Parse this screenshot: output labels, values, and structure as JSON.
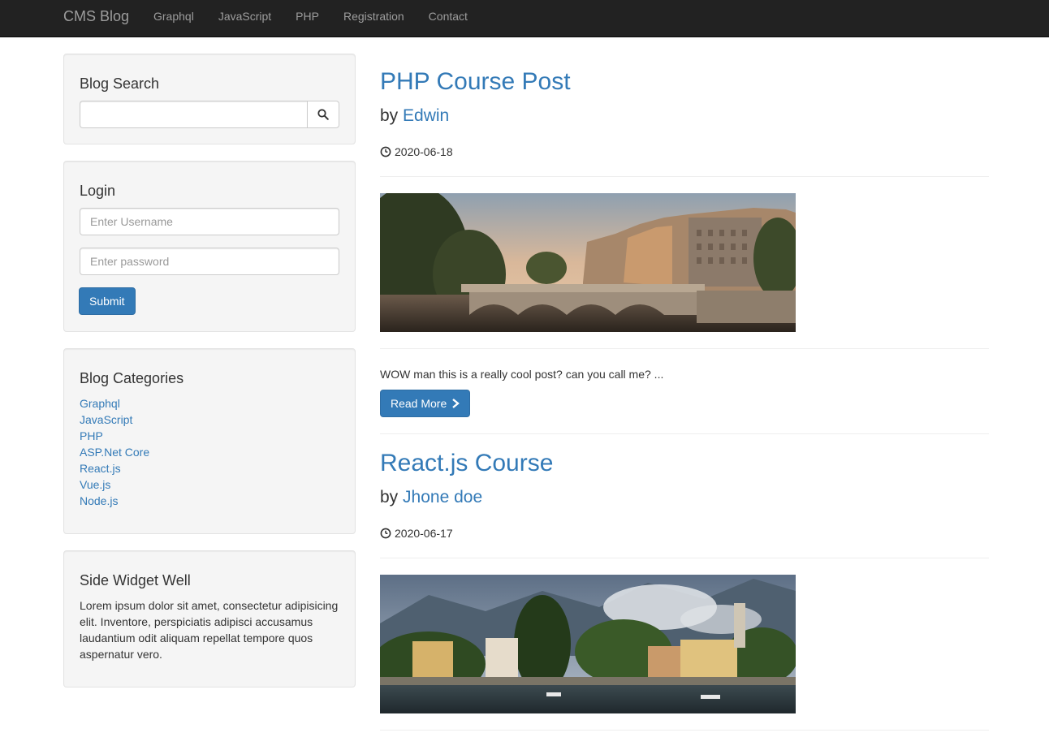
{
  "navbar": {
    "brand": "CMS Blog",
    "links": [
      "Graphql",
      "JavaScript",
      "PHP",
      "Registration",
      "Contact"
    ]
  },
  "search": {
    "title": "Blog Search",
    "icon": "search-icon"
  },
  "login": {
    "title": "Login",
    "username_placeholder": "Enter Username",
    "password_placeholder": "Enter password",
    "submit_label": "Submit"
  },
  "categories": {
    "title": "Blog Categories",
    "items": [
      "Graphql",
      "JavaScript",
      "PHP",
      "ASP.Net Core",
      "React.js",
      "Vue.js",
      "Node.js"
    ]
  },
  "widget": {
    "title": "Side Widget Well",
    "text": "Lorem ipsum dolor sit amet, consectetur adipisicing elit. Inventore, perspiciatis adipisci accusamus laudantium odit aliquam repellat tempore quos aspernatur vero."
  },
  "posts": [
    {
      "title": "PHP Course Post",
      "by": "by",
      "author": "Edwin",
      "date": "2020-06-18",
      "excerpt": "WOW man this is a really cool post? can you call me? ...",
      "read_more": "Read More"
    },
    {
      "title": "React.js Course",
      "by": "by",
      "author": "Jhone doe",
      "date": "2020-06-17"
    }
  ],
  "colors": {
    "navbar": "#222222",
    "link": "#337ab7",
    "primary_button": "#337ab7",
    "well": "#f5f5f5"
  }
}
